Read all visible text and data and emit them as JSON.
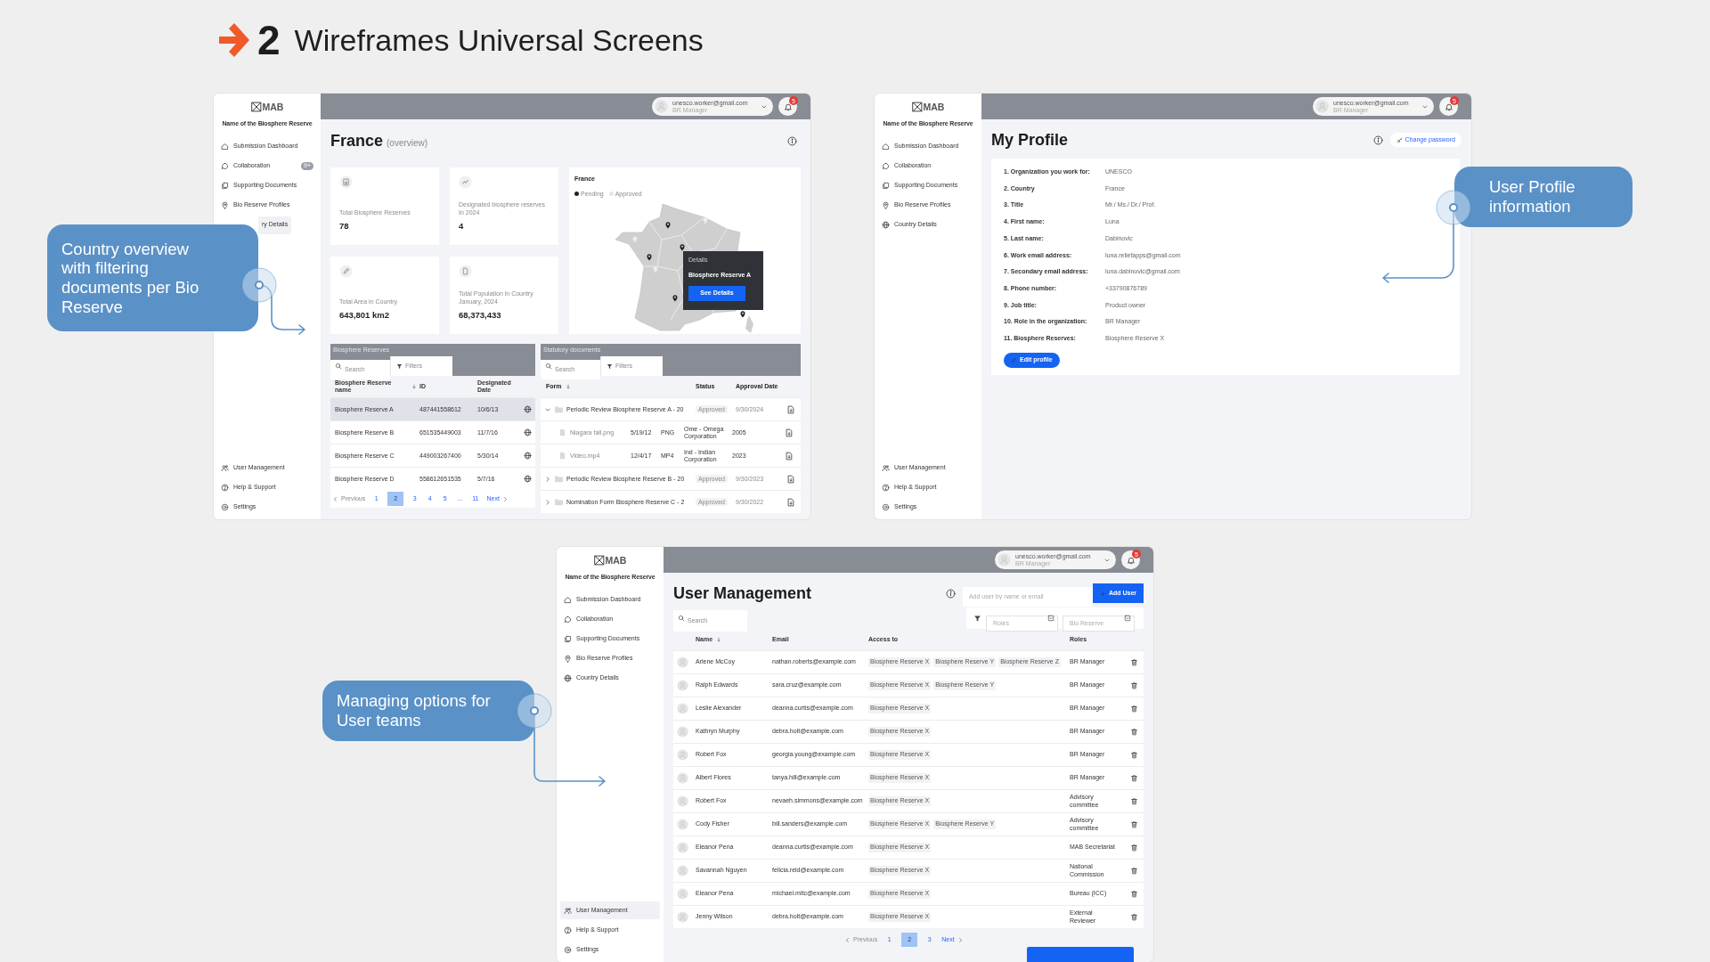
{
  "heading": {
    "number": "2",
    "title": "Wireframes Universal Screens"
  },
  "screens": [
    {
      "kind": "overview",
      "sidebar": {
        "logo": "MAB",
        "reserve_name": "Name of the Biosphere Reserve",
        "items": [
          {
            "label": "Submission Dashboard",
            "selected": false
          },
          {
            "label": "Collaboration",
            "selected": false,
            "badge": "9+"
          },
          {
            "label": "Supporting Documents",
            "selected": false
          },
          {
            "label": "Bio Reserve Profiles",
            "selected": false
          },
          {
            "label": "ry Details",
            "selected": true
          }
        ],
        "bottom_items": [
          {
            "label": "User Management",
            "selected": false
          },
          {
            "label": "Help & Support",
            "selected": false
          },
          {
            "label": "Settings",
            "selected": false
          }
        ]
      },
      "user": {
        "email": "unesco.worker@gmail.com",
        "role": "BR Manager",
        "notifications": "5"
      },
      "title": "France",
      "subtitle": "(overview)",
      "stats": [
        {
          "label": "Total Biosphere Reserves",
          "value": "78"
        },
        {
          "label": "Designated biosphere reserves\nIn 2024",
          "value": "4"
        },
        {
          "label": "Total Area in Country",
          "value": "643,801 km2"
        },
        {
          "label": "Total Population in Country\nJanuary, 2024",
          "value": "68,373,433"
        }
      ],
      "map": {
        "title": "France",
        "legend": [
          {
            "label": "Pending",
            "color": "#222222"
          },
          {
            "label": "Approved",
            "color": "#e6e6e6"
          }
        ],
        "tooltip": {
          "heading": "Details",
          "name": "Biosphere Reserve A",
          "button": "See Details"
        }
      },
      "reserves": {
        "title": "Biosphere Reserves",
        "search": {
          "placeholder": "Search"
        },
        "filter": "Filters",
        "columns": [
          "Biosphere Reserve name",
          "ID",
          "Designated\nDate"
        ],
        "rows": [
          {
            "name": "Biosphere Reserve A",
            "id": "487441558612",
            "date": "10/6/13",
            "selected": true
          },
          {
            "name": "Biosphere Reserve B",
            "id": "651535449003",
            "date": "11/7/16",
            "selected": false
          },
          {
            "name": "Biosphere Reserve C",
            "id": "449003267400",
            "date": "5/30/14",
            "selected": false
          },
          {
            "name": "Biosphere Reserve D",
            "id": "558612651535",
            "date": "5/7/16",
            "selected": false
          }
        ],
        "pagination": {
          "previous": "Previous",
          "next": "Next",
          "pages": [
            {
              "label": "1",
              "selected": false
            },
            {
              "label": "2",
              "selected": true
            },
            {
              "label": "3",
              "selected": false
            },
            {
              "label": "4",
              "selected": false
            },
            {
              "label": "5",
              "selected": false
            },
            {
              "label": "...",
              "selected": false
            },
            {
              "label": "11",
              "selected": false
            }
          ]
        }
      },
      "documents": {
        "title": "Statutory documents",
        "search": {
          "placeholder": "Search"
        },
        "filter": "Filters",
        "columns": [
          "Form",
          "Status",
          "Approval Date"
        ],
        "rows": [
          {
            "kind": "folder",
            "expanded": true,
            "name": "Periodic Review Biosphere Reserve A - 20",
            "status": "Approved",
            "date": "9/30/2024"
          },
          {
            "kind": "file",
            "name": "Niagara fall.png",
            "date": "5/19/12",
            "type": "PNG",
            "owner": "Ome - Omega\nCorporation",
            "year": "2005"
          },
          {
            "kind": "file",
            "name": "Video.mp4",
            "date": "12/4/17",
            "type": "MP4",
            "owner": "Ind - Indian\nCorporation",
            "year": "2023"
          },
          {
            "kind": "folder",
            "expanded": false,
            "name": "Periodic Review Biosphere Reserve B - 20",
            "status": "Approved",
            "date": "9/30/2023"
          },
          {
            "kind": "folder",
            "expanded": false,
            "name": "Nomination Form Biosphere Reserve C - 2",
            "status": "Approved",
            "date": "9/30/2022"
          }
        ]
      }
    },
    {
      "kind": "profile",
      "sidebar": {
        "logo": "MAB",
        "reserve_name": "Name of the Biosphere Reserve",
        "items": [
          {
            "label": "Submission Dashboard",
            "selected": false
          },
          {
            "label": "Collaboration",
            "selected": false
          },
          {
            "label": "Supporting Documents",
            "selected": false
          },
          {
            "label": "Bio Reserve Profiles",
            "selected": false
          },
          {
            "label": "Country Details",
            "selected": false
          }
        ],
        "bottom_items": [
          {
            "label": "User Management",
            "selected": false
          },
          {
            "label": "Help & Support",
            "selected": false
          },
          {
            "label": "Settings",
            "selected": false
          }
        ]
      },
      "user": {
        "email": "unesco.worker@gmail.com",
        "role": "BR Manager",
        "notifications": "5"
      },
      "title": "My Profile",
      "change_password": "Change password",
      "fields": [
        {
          "label": "1. Organization you work for:",
          "value": "UNESCO"
        },
        {
          "label": "2. Country",
          "value": "France"
        },
        {
          "label": "3. Title",
          "value": "Mr./ Ms./ Dr./ Prof."
        },
        {
          "label": "4. First name:",
          "value": "Luna"
        },
        {
          "label": "5. Last name:",
          "value": "Dabinovic"
        },
        {
          "label": "6. Work email address:",
          "value": "luna.reliefapps@gmail.com"
        },
        {
          "label": "7. Secondary email address:",
          "value": "luna.dabinovic@gmail.com"
        },
        {
          "label": "8. Phone number:",
          "value": "+33790876789"
        },
        {
          "label": "9. Job title:",
          "value": "Product owner"
        },
        {
          "label": "10. Role in the organization:",
          "value": "BR Manager"
        },
        {
          "label": "11. Biosphere Reserves:",
          "value": "Biosphere Reserve X"
        }
      ],
      "edit_button": "Edit profile"
    },
    {
      "kind": "users",
      "sidebar": {
        "logo": "MAB",
        "reserve_name": "Name of the Biosphere Reserve",
        "items": [
          {
            "label": "Submission Dashboard",
            "selected": false
          },
          {
            "label": "Collaboration",
            "selected": false
          },
          {
            "label": "Supporting Documents",
            "selected": false
          },
          {
            "label": "Bio Reserve Profiles",
            "selected": false
          },
          {
            "label": "Country Details",
            "selected": false
          }
        ],
        "bottom_items": [
          {
            "label": "User Management",
            "selected": true
          },
          {
            "label": "Help & Support",
            "selected": false
          },
          {
            "label": "Settings",
            "selected": false
          }
        ]
      },
      "user": {
        "email": "unesco.worker@gmail.com",
        "role": "BR Manager",
        "notifications": "5"
      },
      "title": "User Management",
      "add_field": {
        "placeholder": "Add user by name or email"
      },
      "add_button": "Add User",
      "search": {
        "placeholder": "Search"
      },
      "filters": [
        {
          "placeholder": "Roles"
        },
        {
          "placeholder": "Bio Reserve"
        }
      ],
      "columns": [
        "Name",
        "Email",
        "Access to",
        "Roles"
      ],
      "rows": [
        {
          "name": "Arlene McCoy",
          "email": "nathan.roberts@example.com",
          "access": [
            "Biosphere Reserve X",
            "Biosphere Reserve Y",
            "Biosphere Reserve Z"
          ],
          "role": "BR Manager"
        },
        {
          "name": "Ralph Edwards",
          "email": "sara.cruz@example.com",
          "access": [
            "Biosphere Reserve X",
            "Biosphere Reserve Y"
          ],
          "role": "BR Manager"
        },
        {
          "name": "Leslie Alexander",
          "email": "deanna.curtis@example.com",
          "access": [
            "Biosphere Reserve X"
          ],
          "role": "BR Manager"
        },
        {
          "name": "Kathryn Murphy",
          "email": "debra.holt@example.com",
          "access": [
            "Biosphere Reserve X"
          ],
          "role": "BR Manager"
        },
        {
          "name": "Robert Fox",
          "email": "georgia.young@example.com",
          "access": [
            "Biosphere Reserve X"
          ],
          "role": "BR Manager"
        },
        {
          "name": "Albert Flores",
          "email": "tanya.hill@example.com",
          "access": [
            "Biosphere Reserve X"
          ],
          "role": "BR Manager"
        },
        {
          "name": "Robert Fox",
          "email": "nevaeh.simmons@example.com",
          "access": [
            "Biosphere Reserve X"
          ],
          "role": "Advisory\ncommittee"
        },
        {
          "name": "Cody Fisher",
          "email": "bill.sanders@example.com",
          "access": [
            "Biosphere Reserve X",
            "Biosphere Reserve Y"
          ],
          "role": "Advisory\ncommittee"
        },
        {
          "name": "Eleanor Pena",
          "email": "deanna.curtis@example.com",
          "access": [
            "Biosphere Reserve X"
          ],
          "role": "MAB Secretariat"
        },
        {
          "name": "Savannah Nguyen",
          "email": "felicia.reid@example.com",
          "access": [
            "Biosphere Reserve X"
          ],
          "role": "National\nCommission"
        },
        {
          "name": "Eleanor Pena",
          "email": "michael.mitc@example.com",
          "access": [
            "Biosphere Reserve X"
          ],
          "role": "Bureau (ICC)"
        },
        {
          "name": "Jenny Wilson",
          "email": "debra.holt@example.com",
          "access": [
            "Biosphere Reserve X"
          ],
          "role": "External\nReviewer"
        }
      ],
      "pagination": {
        "previous": "Previous",
        "next": "Next",
        "pages": [
          {
            "label": "1",
            "selected": false
          },
          {
            "label": "2",
            "selected": true
          },
          {
            "label": "3",
            "selected": false
          }
        ]
      }
    }
  ],
  "callouts": [
    {
      "text": "Country overview\nwith filtering\ndocuments per Bio\nReserve"
    },
    {
      "text": "User Profile\ninformation"
    },
    {
      "text": "Managing options for\nUser teams"
    }
  ]
}
